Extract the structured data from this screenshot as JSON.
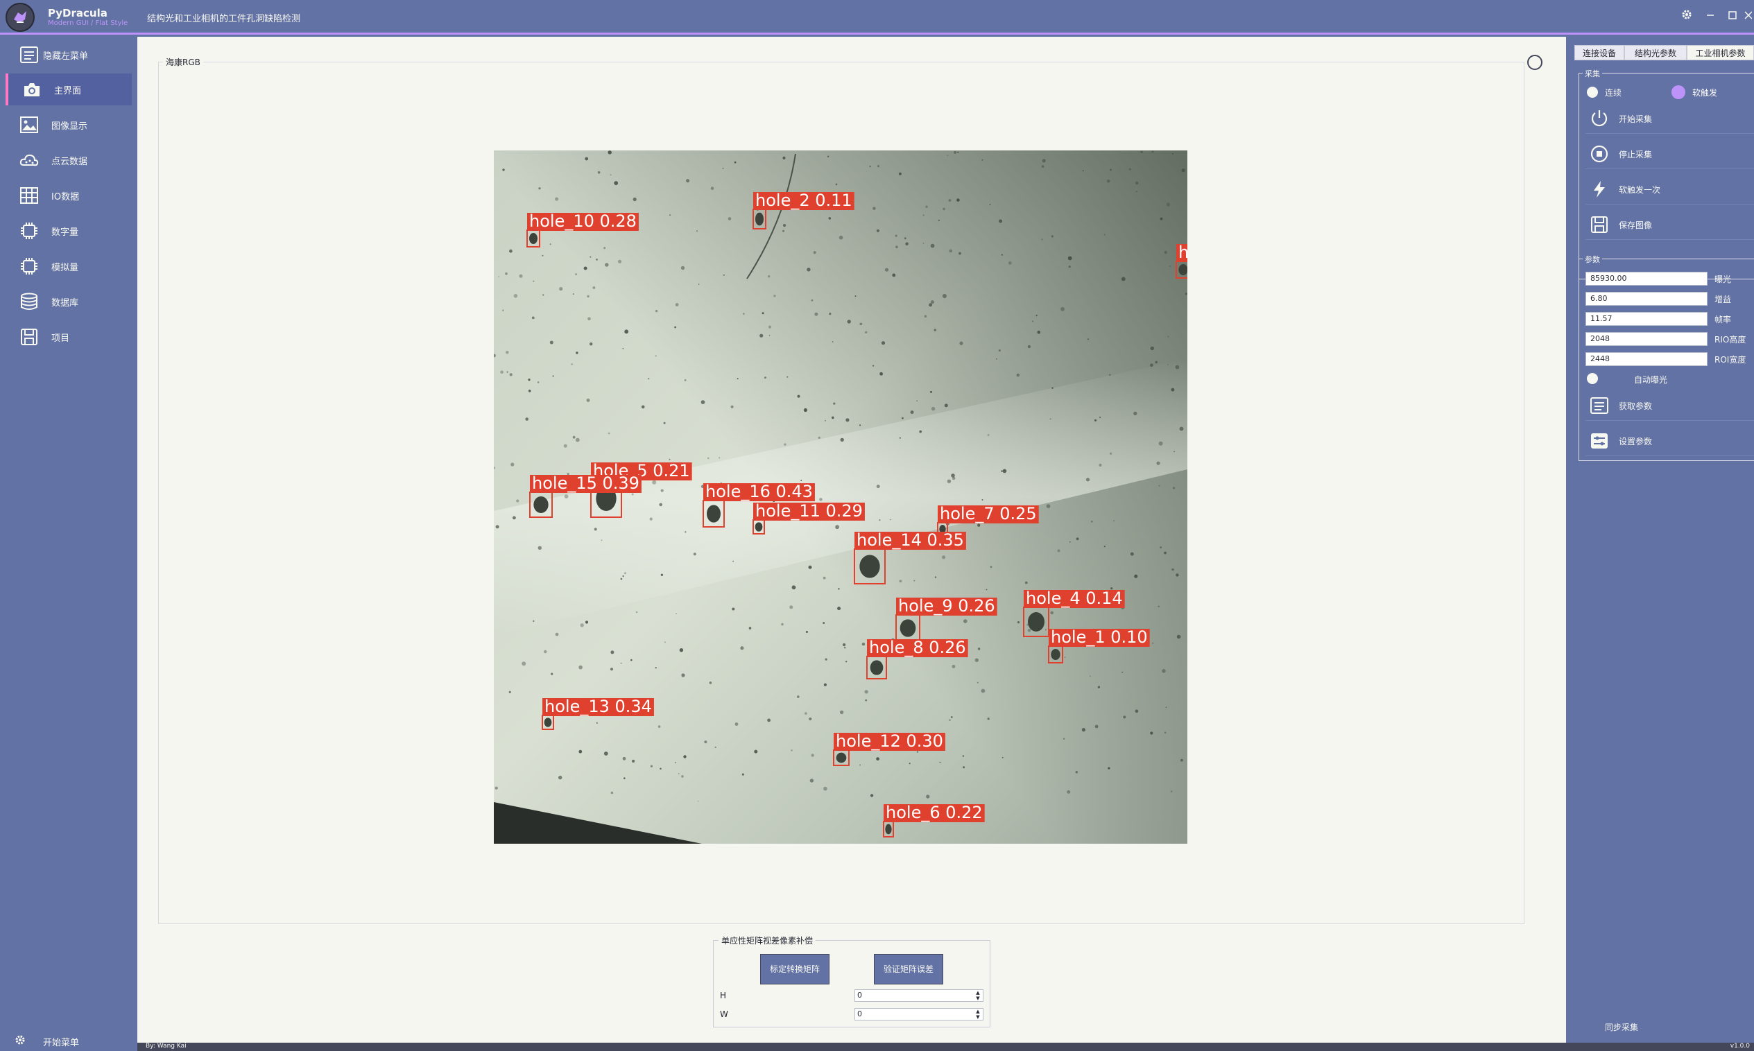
{
  "app": {
    "name": "PyDracula",
    "subtitle": "Modern GUI / Flat Style",
    "title": "结构光和工业相机的工件孔洞缺陷检测"
  },
  "colors": {
    "bg": "#6272a4",
    "accent": "#bd93f9",
    "active": "#ff79c6",
    "content": "#f6f6f1",
    "box": "#e0412f"
  },
  "left_menu": {
    "toggle": "隐藏左菜单",
    "items": [
      {
        "label": "主界面",
        "icon": "camera-icon"
      },
      {
        "label": "图像显示",
        "icon": "image-icon"
      },
      {
        "label": "点云数据",
        "icon": "cloud-icon"
      },
      {
        "label": "IO数据",
        "icon": "table-icon"
      },
      {
        "label": "数字量",
        "icon": "chip-icon"
      },
      {
        "label": "模拟量",
        "icon": "chip-icon"
      },
      {
        "label": "数据库",
        "icon": "database-icon"
      },
      {
        "label": "项目",
        "icon": "save-icon"
      }
    ],
    "footer": "开始菜单"
  },
  "main": {
    "view_title": "海康RGB",
    "detections": [
      {
        "label": "hole_10 0.28"
      },
      {
        "label": "hole_2 0.11"
      },
      {
        "label": "h"
      },
      {
        "label": "hole_5 0.21"
      },
      {
        "label": "hole_15 0.39"
      },
      {
        "label": "hole_16 0.43"
      },
      {
        "label": "hole_11 0.29"
      },
      {
        "label": "hole_7 0.25"
      },
      {
        "label": "hole_14 0.35"
      },
      {
        "label": "hole_4 0.14"
      },
      {
        "label": "hole_9 0.26"
      },
      {
        "label": "hole_1 0.10"
      },
      {
        "label": "hole_8 0.26"
      },
      {
        "label": "hole_13 0.34"
      },
      {
        "label": "hole_12 0.30"
      },
      {
        "label": "hole_6 0.22"
      }
    ],
    "homography": {
      "title": "单应性矩阵视差像素补偿",
      "calibrate_btn": "标定转换矩阵",
      "verify_btn": "验证矩阵误差",
      "h_label": "H",
      "h_value": "0",
      "w_label": "W",
      "w_value": "0"
    }
  },
  "right_panel": {
    "tabs": [
      "连接设备",
      "结构光参数",
      "工业相机参数"
    ],
    "acquire": {
      "title": "采集",
      "mode_continuous": "连续",
      "mode_soft_trigger": "软触发",
      "start": "开始采集",
      "stop": "停止采集",
      "trigger_once": "软触发一次",
      "save_image": "保存图像"
    },
    "params": {
      "title": "参数",
      "exposure_value": "85930.00",
      "exposure_label": "曝光",
      "gain_value": "6.80",
      "gain_label": "增益",
      "fps_value": "11.57",
      "fps_label": "帧率",
      "roi_h_value": "2048",
      "roi_h_label": "RIO高度",
      "roi_w_value": "2448",
      "roi_w_label": "ROI宽度",
      "auto_exposure": "自动曝光",
      "get_params": "获取参数",
      "set_params": "设置参数"
    },
    "sync": "同步采集"
  },
  "status": {
    "author": "By: Wang Kai",
    "version": "v1.0.0"
  }
}
